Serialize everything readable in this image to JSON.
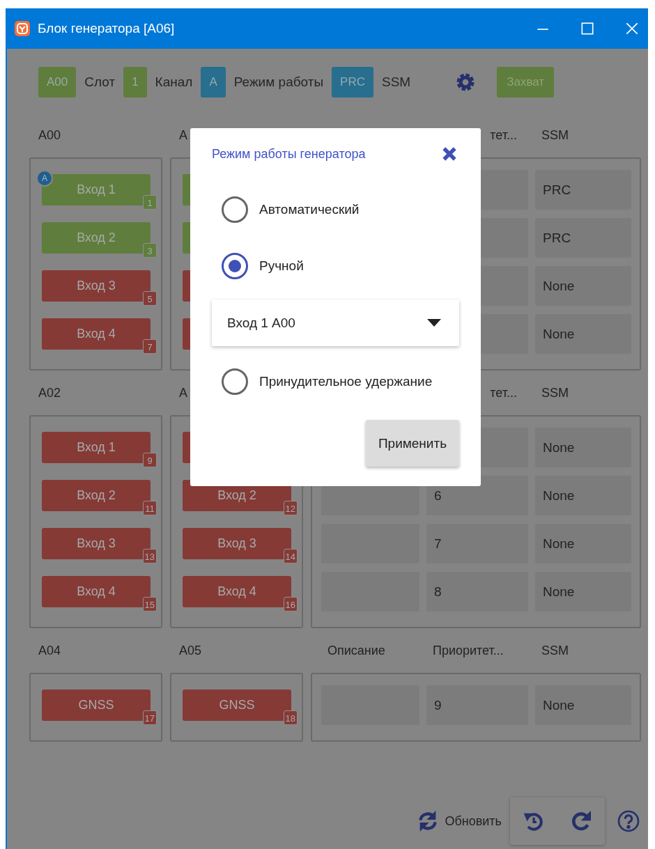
{
  "window": {
    "title": "Блок генератора [A06]"
  },
  "toolbar": {
    "legend": [
      {
        "chip": "A00",
        "label": "Слот",
        "color": "#5f7d3c"
      },
      {
        "chip": "1",
        "label": "Канал",
        "color": "#5f7d3c"
      },
      {
        "chip": "A",
        "label": "Режим работы",
        "color": "#276e8f"
      },
      {
        "chip": "PRC",
        "label": "SSM",
        "color": "#276e8f"
      }
    ],
    "capture_button": "Захват"
  },
  "sections": [
    {
      "slots": [
        {
          "name": "A00",
          "inputs": [
            {
              "label": "Вход 1",
              "number": "1",
              "color": "#5f7d3c",
              "mode": "A"
            },
            {
              "label": "Вход 2",
              "number": "3",
              "color": "#5f7d3c"
            },
            {
              "label": "Вход 3",
              "number": "5",
              "color": "#853a36"
            },
            {
              "label": "Вход 4",
              "number": "7",
              "color": "#853a36"
            }
          ]
        },
        {
          "name": "A",
          "inputs": [
            {
              "color": "#5f7d3c"
            },
            {
              "color": "#5f7d3c"
            },
            {
              "color": "#853a36"
            },
            {
              "color": "#853a36"
            }
          ]
        }
      ],
      "columns": {
        "priority": "тет...",
        "priority_partial": true,
        "ssm": "SSM"
      },
      "rows": [
        {
          "ssm": "PRC"
        },
        {
          "ssm": "PRC"
        },
        {
          "ssm": "None"
        },
        {
          "ssm": "None"
        }
      ]
    },
    {
      "slots": [
        {
          "name": "A02",
          "inputs": [
            {
              "label": "Вход 1",
              "number": "9",
              "color": "#853a36"
            },
            {
              "label": "Вход 2",
              "number": "11",
              "color": "#853a36"
            },
            {
              "label": "Вход 3",
              "number": "13",
              "color": "#853a36"
            },
            {
              "label": "Вход 4",
              "number": "15",
              "color": "#853a36"
            }
          ]
        },
        {
          "name": "A",
          "inputs": [
            {
              "color": "#853a36"
            },
            {
              "label": "Вход 2",
              "number": "12",
              "color": "#853a36"
            },
            {
              "label": "Вход 3",
              "number": "14",
              "color": "#853a36"
            },
            {
              "label": "Вход 4",
              "number": "16",
              "color": "#853a36"
            }
          ]
        }
      ],
      "columns": {
        "priority": "тет...",
        "priority_partial": true,
        "ssm": "SSM"
      },
      "rows": [
        {
          "ssm": "None"
        },
        {
          "priority": "6",
          "ssm": "None"
        },
        {
          "priority": "7",
          "ssm": "None"
        },
        {
          "priority": "8",
          "ssm": "None"
        }
      ]
    },
    {
      "slots": [
        {
          "name": "A04",
          "inputs": [
            {
              "label": "GNSS",
              "number": "17",
              "color": "#853a36"
            }
          ]
        },
        {
          "name": "A05",
          "inputs": [
            {
              "label": "GNSS",
              "number": "18",
              "color": "#853a36"
            }
          ]
        }
      ],
      "columns": {
        "description": "Описание",
        "priority": "Приоритет...",
        "priority_partial": false,
        "ssm": "SSM"
      },
      "rows": [
        {
          "priority": "9",
          "ssm": "None"
        }
      ]
    }
  ],
  "footer": {
    "refresh_label": "Обновить"
  },
  "dialog": {
    "title": "Режим работы генератора",
    "options": [
      {
        "label": "Автоматический",
        "selected": false
      },
      {
        "label": "Ручной",
        "selected": true
      },
      {
        "label": "Принудительное удержание",
        "selected": false
      }
    ],
    "source_select": {
      "value": "Вход 1 A00"
    },
    "apply_button": "Применить"
  }
}
